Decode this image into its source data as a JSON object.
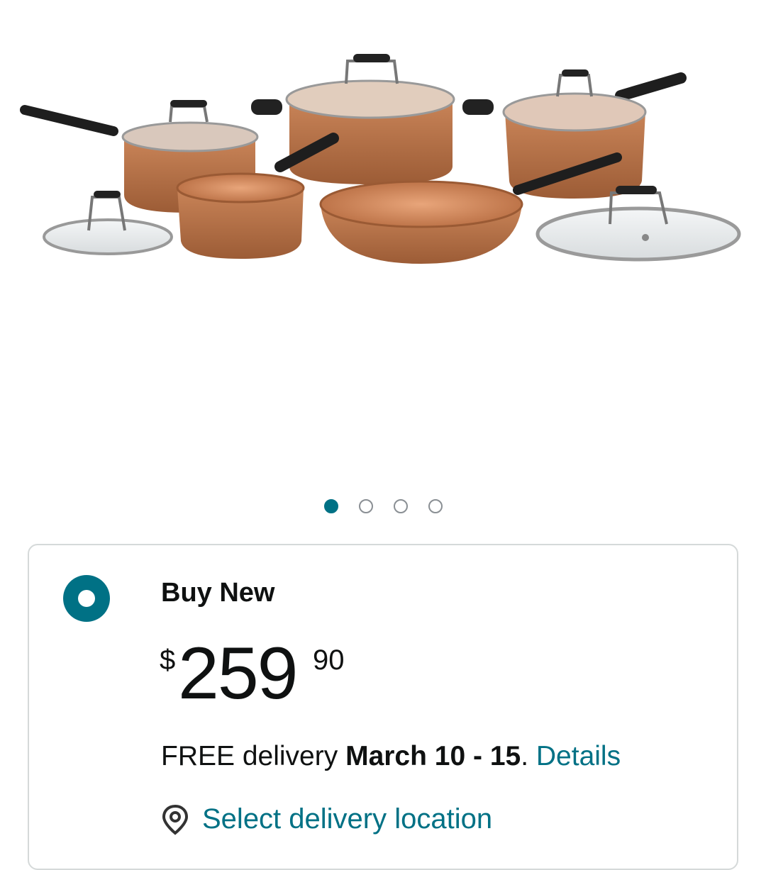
{
  "gallery": {
    "image_alt": "Copper cookware set with glass lids",
    "dots": [
      {
        "active": true
      },
      {
        "active": false
      },
      {
        "active": false
      },
      {
        "active": false
      }
    ]
  },
  "offer": {
    "title": "Buy New",
    "price": {
      "symbol": "$",
      "whole": "259",
      "fraction": "90"
    },
    "delivery": {
      "prefix": "FREE delivery ",
      "dates": "March 10 - 15",
      "separator": ". ",
      "details_link": "Details"
    },
    "location_link": "Select delivery location"
  },
  "colors": {
    "accent": "#007185",
    "copper": "#b8734a"
  },
  "icons": {
    "location": "location-pin-icon"
  }
}
